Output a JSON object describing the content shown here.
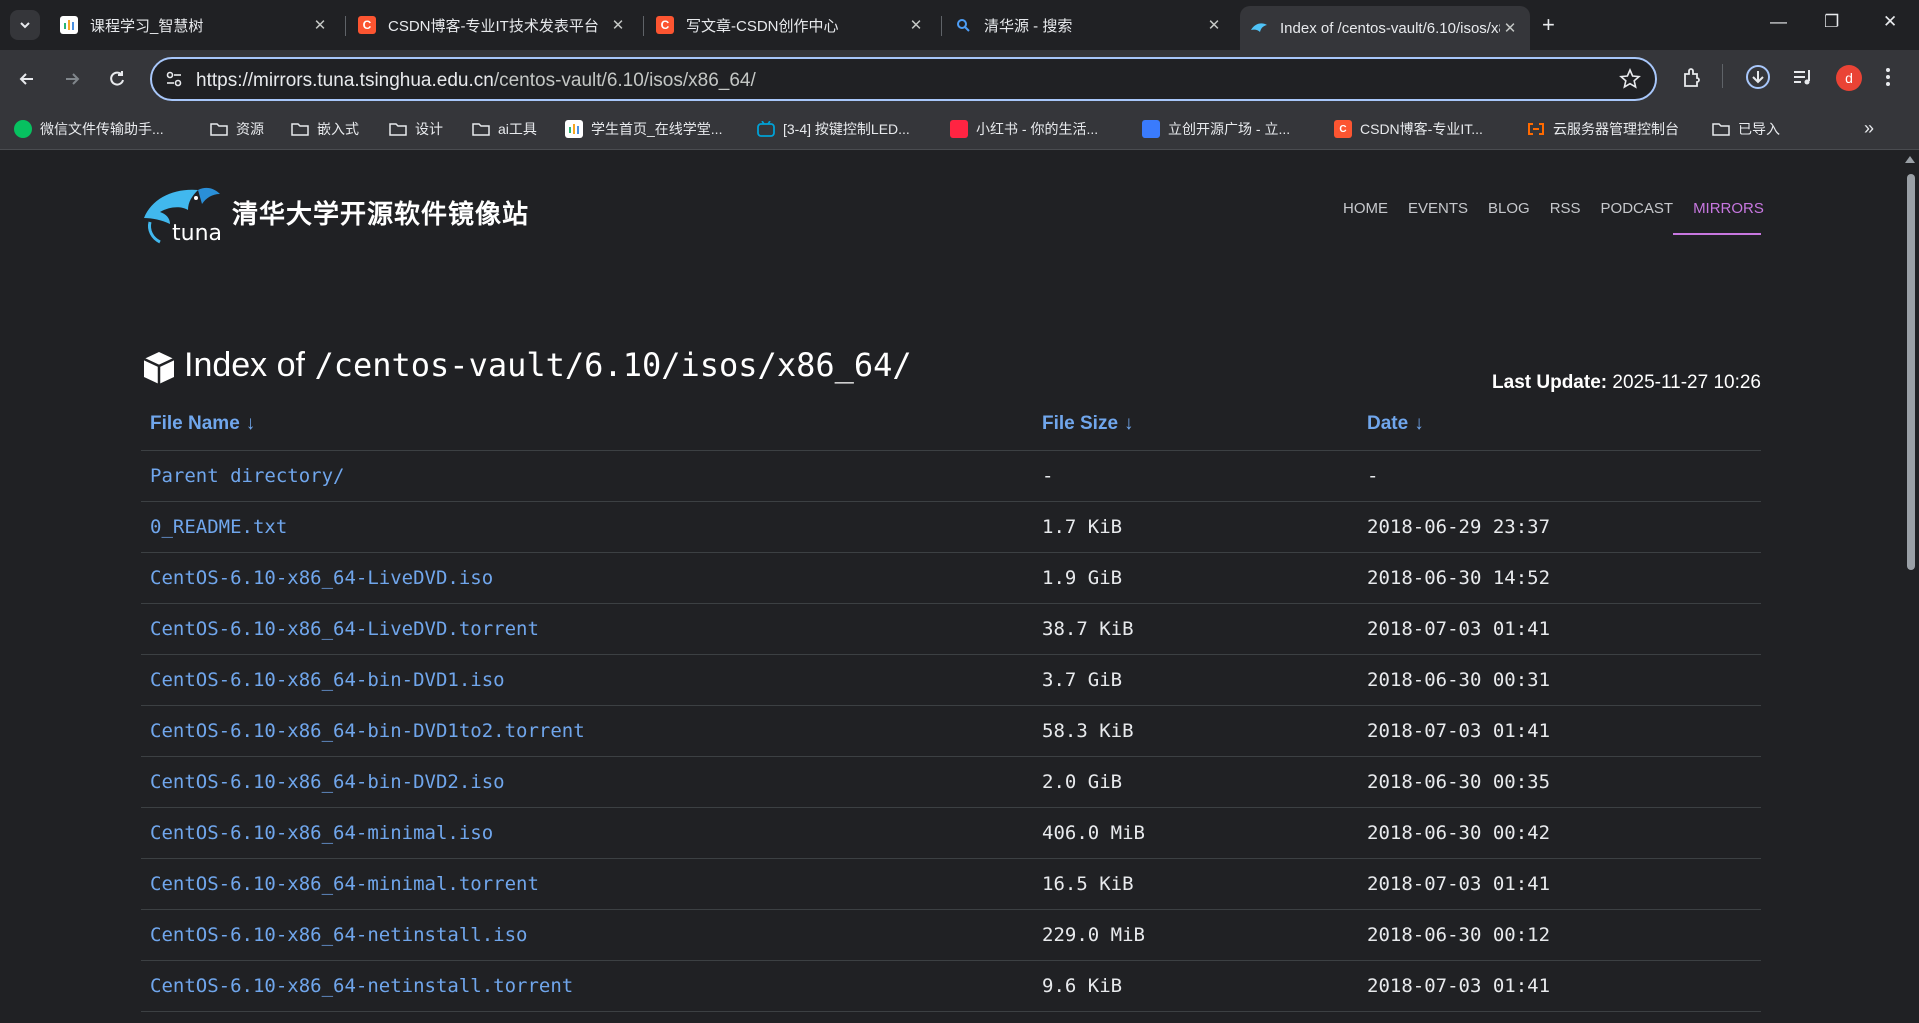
{
  "browser": {
    "tabs": [
      {
        "title": "课程学习_智慧树",
        "icon": "zhihuishu-icon",
        "active": false
      },
      {
        "title": "CSDN博客-专业IT技术发表平台",
        "icon": "csdn-icon",
        "active": false
      },
      {
        "title": "写文章-CSDN创作中心",
        "icon": "csdn-icon",
        "active": false
      },
      {
        "title": "清华源 - 搜索",
        "icon": "search-icon",
        "active": false
      },
      {
        "title": "Index of /centos-vault/6.10/isos/x86_64/",
        "icon": "tuna-icon",
        "active": true
      }
    ],
    "close_glyph": "✕",
    "new_tab_glyph": "+",
    "window_controls": {
      "minimize": "—",
      "restore": "❐",
      "close": "✕"
    },
    "address": {
      "host": "https://mirrors.tuna.tsinghua.edu.cn",
      "path": "/centos-vault/6.10/isos/x86_64/"
    },
    "profile_letter": "d",
    "bookmarks": [
      {
        "label": "微信文件传输助手...",
        "icon": "wechat-icon",
        "color": "#07c160"
      },
      {
        "label": "资源",
        "icon": "folder-icon"
      },
      {
        "label": "嵌入式",
        "icon": "folder-icon"
      },
      {
        "label": "设计",
        "icon": "folder-icon"
      },
      {
        "label": "ai工具",
        "icon": "folder-icon"
      },
      {
        "label": "学生首页_在线学堂...",
        "icon": "zhihuishu-icon",
        "color": "#ffffff"
      },
      {
        "label": "[3-4] 按键控制LED...",
        "icon": "bilibili-icon",
        "color": "#00a1d6"
      },
      {
        "label": "小红书 - 你的生活...",
        "icon": "xiaohongshu-icon",
        "color": "#ff2442"
      },
      {
        "label": "立创开源广场 - 立...",
        "icon": "oshwhub-icon",
        "color": "#3a7bfd"
      },
      {
        "label": "CSDN博客-专业IT...",
        "icon": "csdn-icon",
        "color": "#fc5531"
      },
      {
        "label": "云服务器管理控制台",
        "icon": "aliyun-icon",
        "color": "#ff6a00"
      },
      {
        "label": "已导入",
        "icon": "folder-icon"
      }
    ],
    "bookmarks_more": "»"
  },
  "site": {
    "title": "清华大学开源软件镜像站",
    "nav": [
      "HOME",
      "EVENTS",
      "BLOG",
      "RSS",
      "PODCAST",
      "MIRRORS"
    ],
    "active_nav": "MIRRORS",
    "accent": "#c777e0",
    "link_color": "#70a6ec"
  },
  "listing": {
    "title_prefix": "Index of",
    "title_path": "/centos-vault/6.10/isos/x86_64/",
    "last_update_label": "Last Update:",
    "last_update_value": "2025-11-27 10:26",
    "columns": [
      "File Name",
      "File Size",
      "Date"
    ],
    "sort_arrow": "↓",
    "rows": [
      {
        "name": "Parent directory/",
        "size": "-",
        "date": "-"
      },
      {
        "name": "0_README.txt",
        "size": "1.7 KiB",
        "date": "2018-06-29 23:37"
      },
      {
        "name": "CentOS-6.10-x86_64-LiveDVD.iso",
        "size": "1.9 GiB",
        "date": "2018-06-30 14:52"
      },
      {
        "name": "CentOS-6.10-x86_64-LiveDVD.torrent",
        "size": "38.7 KiB",
        "date": "2018-07-03 01:41"
      },
      {
        "name": "CentOS-6.10-x86_64-bin-DVD1.iso",
        "size": "3.7 GiB",
        "date": "2018-06-30 00:31"
      },
      {
        "name": "CentOS-6.10-x86_64-bin-DVD1to2.torrent",
        "size": "58.3 KiB",
        "date": "2018-07-03 01:41"
      },
      {
        "name": "CentOS-6.10-x86_64-bin-DVD2.iso",
        "size": "2.0 GiB",
        "date": "2018-06-30 00:35"
      },
      {
        "name": "CentOS-6.10-x86_64-minimal.iso",
        "size": "406.0 MiB",
        "date": "2018-06-30 00:42"
      },
      {
        "name": "CentOS-6.10-x86_64-minimal.torrent",
        "size": "16.5 KiB",
        "date": "2018-07-03 01:41"
      },
      {
        "name": "CentOS-6.10-x86_64-netinstall.iso",
        "size": "229.0 MiB",
        "date": "2018-06-30 00:12"
      },
      {
        "name": "CentOS-6.10-x86_64-netinstall.torrent",
        "size": "9.6 KiB",
        "date": "2018-07-03 01:41"
      }
    ]
  }
}
